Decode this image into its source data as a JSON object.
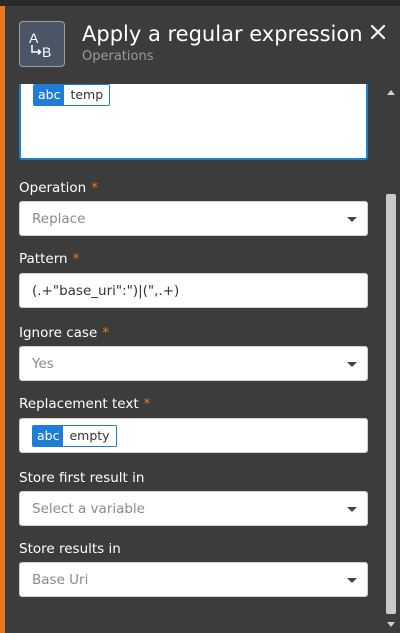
{
  "header": {
    "title": "Apply a regular expression",
    "subtitle": "Operations",
    "icon": "regex-replace-icon",
    "icon_letter_a": "A",
    "icon_letter_b": "B"
  },
  "fields": {
    "text": {
      "chip_type": "abc",
      "chip_value": "temp"
    },
    "operation": {
      "label": "Operation",
      "required": "*",
      "value": "Replace"
    },
    "pattern": {
      "label": "Pattern",
      "required": "*",
      "value": "(.+\"base_uri\":\")|(\",.+)"
    },
    "ignore_case": {
      "label": "Ignore case",
      "required": "*",
      "value": "Yes"
    },
    "replacement": {
      "label": "Replacement text",
      "required": "*",
      "chip_type": "abc",
      "chip_value": "empty"
    },
    "store_first": {
      "label": "Store first result in",
      "placeholder": "Select a variable"
    },
    "store_results": {
      "label": "Store results in",
      "value": "Base Uri"
    }
  },
  "colors": {
    "accent": "#e8791e",
    "chip": "#1f7dd6",
    "panel": "#3c3c3c"
  }
}
